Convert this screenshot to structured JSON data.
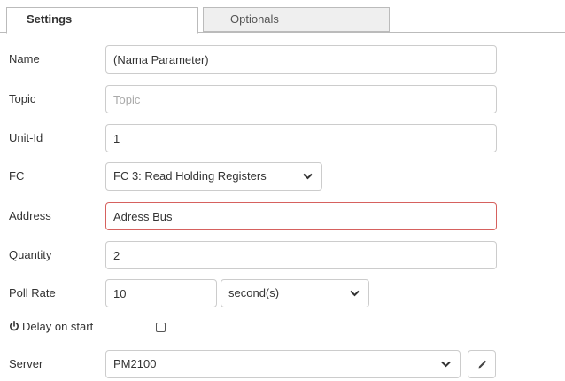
{
  "tabs": [
    {
      "label": "Settings",
      "active": true
    },
    {
      "label": "Optionals",
      "active": false
    }
  ],
  "form": {
    "name": {
      "label": "Name",
      "value": "(Nama Parameter)"
    },
    "topic": {
      "label": "Topic",
      "value": "",
      "placeholder": "Topic"
    },
    "unit_id": {
      "label": "Unit-Id",
      "value": "1"
    },
    "fc": {
      "label": "FC",
      "selected": "FC 3: Read Holding Registers"
    },
    "address": {
      "label": "Address",
      "value": "Adress Bus",
      "invalid": true
    },
    "quantity": {
      "label": "Quantity",
      "value": "2"
    },
    "poll_rate": {
      "label": "Poll Rate",
      "value": "10",
      "unit": "second(s)"
    },
    "delay_on_start": {
      "label": "Delay on start",
      "checked": false
    },
    "server": {
      "label": "Server",
      "selected": "PM2100"
    }
  },
  "icons": {
    "delay": "power-icon",
    "edit": "pencil-icon",
    "dropdown": "chevron-down-icon"
  },
  "colors": {
    "error_border": "#d6615e",
    "border": "#cccccc",
    "tab_inactive_bg": "#efefef"
  }
}
